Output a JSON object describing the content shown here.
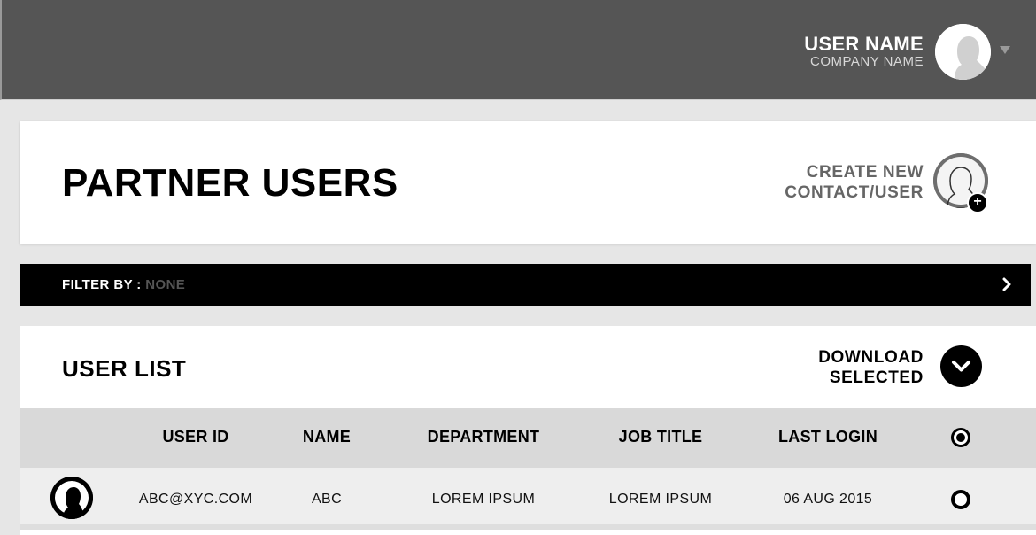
{
  "header": {
    "user_name": "USER NAME",
    "company_name": "COMPANY NAME",
    "avatar_icon": "user-silhouette-icon",
    "menu_icon": "caret-down-icon"
  },
  "page": {
    "title": "PARTNER USERS",
    "create_new_line1": "CREATE NEW",
    "create_new_line2": "CONTACT/USER",
    "create_icon": "add-user-icon"
  },
  "filter": {
    "label": "FILTER BY :",
    "value": "NONE",
    "icon": "chevron-right-icon"
  },
  "user_list": {
    "title": "USER LIST",
    "download_line1": "DOWNLOAD",
    "download_line2": "SELECTED",
    "download_icon": "chevron-down-icon",
    "columns": [
      "USER ID",
      "NAME",
      "DEPARTMENT",
      "JOB TITLE",
      "LAST LOGIN"
    ],
    "rows": [
      {
        "user_id": "ABC@XYC.COM",
        "name": "ABC",
        "department": "LOREM IPSUM",
        "job_title": "LOREM IPSUM",
        "last_login": "06 AUG 2015",
        "selected": false
      }
    ]
  },
  "colors": {
    "topbar": "#555555",
    "background": "#e6e6e6",
    "filter_bar": "#000000",
    "table_head": "#d9d9d9",
    "table_row": "#eeeeee"
  }
}
